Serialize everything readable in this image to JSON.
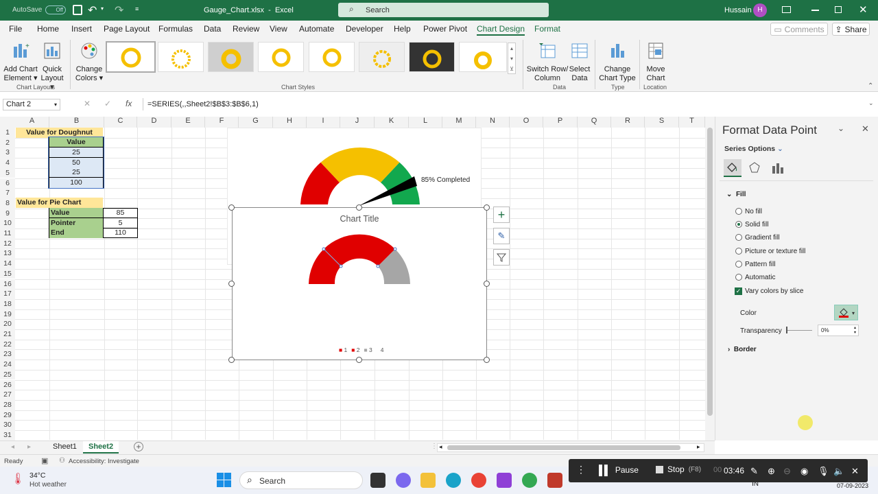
{
  "titlebar": {
    "autosave_label": "AutoSave",
    "autosave_state": "Off",
    "filename": "Gauge_Chart.xlsx",
    "app_name": "Excel",
    "search_placeholder": "Search",
    "user_name": "Hussain",
    "user_initial": "H"
  },
  "menu": {
    "tabs": [
      "File",
      "Home",
      "Insert",
      "Page Layout",
      "Formulas",
      "Data",
      "Review",
      "View",
      "Automate",
      "Developer",
      "Help",
      "Power Pivot",
      "Chart Design",
      "Format"
    ],
    "active_tab": "Chart Design",
    "comments_label": "Comments",
    "share_label": "Share"
  },
  "ribbon": {
    "add_chart_element": "Add Chart Element",
    "add_chart_l1": "Add Chart",
    "add_chart_l2": "Element",
    "quick_l1": "Quick",
    "quick_l2": "Layout",
    "change_colors_l1": "Change",
    "change_colors_l2": "Colors",
    "switch_l1": "Switch Row/",
    "switch_l2": "Column",
    "select_l1": "Select",
    "select_l2": "Data",
    "change_type_l1": "Change",
    "change_type_l2": "Chart Type",
    "move_l1": "Move",
    "move_l2": "Chart",
    "groups": {
      "chart_layouts": "Chart Layouts",
      "chart_styles": "Chart Styles",
      "data": "Data",
      "type": "Type",
      "location": "Location"
    },
    "accent_color": "#1e7145"
  },
  "formula_bar": {
    "name_box": "Chart 2",
    "fx": "fx",
    "formula": "=SERIES(,,Sheet2!$B$3:$B$6,1)"
  },
  "columns": [
    "A",
    "B",
    "C",
    "D",
    "E",
    "F",
    "G",
    "H",
    "I",
    "J",
    "K",
    "L",
    "M",
    "N",
    "O",
    "P",
    "Q",
    "R",
    "S",
    "T"
  ],
  "rows": [
    "1",
    "2",
    "3",
    "4",
    "5",
    "6",
    "7",
    "8",
    "9",
    "10",
    "11",
    "12",
    "13",
    "14",
    "15",
    "16",
    "17",
    "18",
    "19",
    "20",
    "21",
    "22",
    "23",
    "24",
    "25",
    "26",
    "27",
    "28",
    "29",
    "30",
    "31"
  ],
  "sheet": {
    "doughnut_header": "Value for Doughnut",
    "value_header": "Value",
    "doughnut_values": [
      "25",
      "50",
      "25",
      "100"
    ],
    "pie_header": "Value for Pie Chart",
    "pie_rows": [
      {
        "label": "Value",
        "value": "85"
      },
      {
        "label": "Pointer",
        "value": "5"
      },
      {
        "label": "End",
        "value": "110"
      }
    ]
  },
  "gauge_chart": {
    "annotation": "85% Completed",
    "colors": {
      "red": "#e00000",
      "yellow": "#f5c000",
      "green": "#12a84e",
      "pointer": "#000000"
    }
  },
  "selected_chart": {
    "title": "Chart Title",
    "legend": [
      "1",
      "2",
      "3",
      "4"
    ],
    "colors": {
      "red": "#e00000",
      "grey": "#a6a6a6"
    }
  },
  "format_pane": {
    "title": "Format Data Point",
    "series_options": "Series Options",
    "fill_section": "Fill",
    "fill_options": [
      "No fill",
      "Solid fill",
      "Gradient fill",
      "Picture or texture fill",
      "Pattern fill",
      "Automatic"
    ],
    "selected_fill": "Solid fill",
    "vary_colors": "Vary colors by slice",
    "color_label": "Color",
    "transparency_label": "Transparency",
    "transparency_value": "0%",
    "border_section": "Border"
  },
  "sheet_tabs": [
    "Sheet1",
    "Sheet2"
  ],
  "active_sheet": "Sheet2",
  "status": {
    "ready": "Ready",
    "accessibility": "Accessibility: Investigate"
  },
  "taskbar": {
    "temperature": "34°C",
    "weather": "Hot weather",
    "search": "Search",
    "lang": "IN",
    "date": "07-09-2023"
  },
  "recorder": {
    "pause": "Pause",
    "stop": "Stop",
    "stop_key": "(F8)",
    "time_prefix": "00",
    "time": "03:46"
  }
}
